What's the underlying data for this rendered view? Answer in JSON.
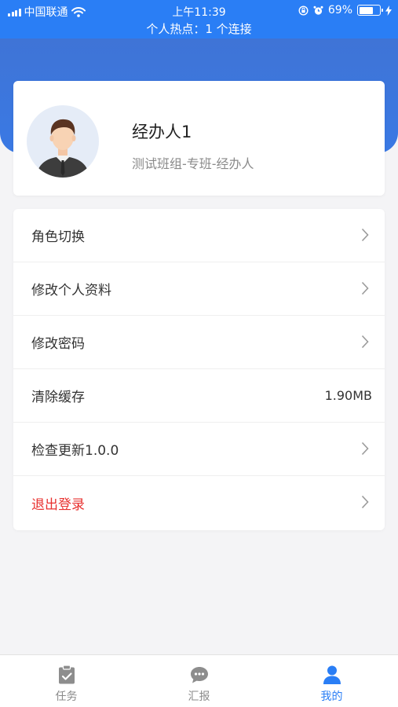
{
  "status_bar": {
    "carrier": "中国联通",
    "time": "上午11:39",
    "battery": "69%",
    "battery_level": 0.69
  },
  "hotspot_banner": "个人热点：1 个连接",
  "profile": {
    "name": "经办人1",
    "role": "测试班组-专班-经办人"
  },
  "menu": {
    "items": [
      {
        "label": "角色切换",
        "icon": "chevron-right-icon"
      },
      {
        "label": "修改个人资料",
        "icon": "chevron-right-icon"
      },
      {
        "label": "修改密码",
        "icon": "chevron-right-icon"
      },
      {
        "label": "清除缓存",
        "value": "1.90MB"
      },
      {
        "label": "检查更新1.0.0",
        "icon": "chevron-right-icon"
      },
      {
        "label": "退出登录",
        "icon": "chevron-right-icon",
        "color": "#e8312f"
      }
    ]
  },
  "tabbar": {
    "tabs": [
      {
        "label": "任务",
        "icon": "clipboard-check-icon",
        "active": false
      },
      {
        "label": "汇报",
        "icon": "chat-bubble-icon",
        "active": false
      },
      {
        "label": "我的",
        "icon": "user-icon",
        "active": true
      }
    ]
  },
  "colors": {
    "primary": "#2a7ef5",
    "header": "#3a79e4",
    "danger": "#e8312f",
    "tab_inactive": "#8a8a8a"
  }
}
